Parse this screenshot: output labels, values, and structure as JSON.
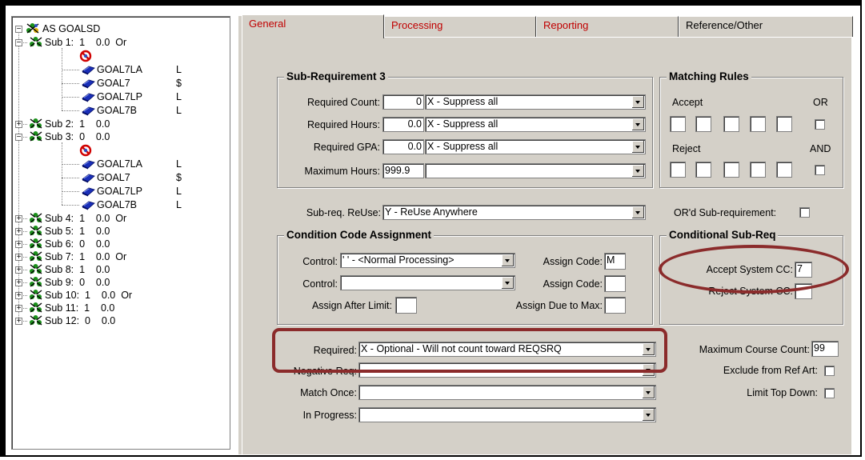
{
  "tree": {
    "root": "AS GOALSD",
    "subs": [
      {
        "label": "Sub 1:  1    0.0  Or",
        "expanded": true,
        "children": [
          {
            "name": "GOAL7LA",
            "tag": "L"
          },
          {
            "name": "GOAL7",
            "tag": "$"
          },
          {
            "name": "GOAL7LP",
            "tag": "L"
          },
          {
            "name": "GOAL7B",
            "tag": "L"
          }
        ]
      },
      {
        "label": "Sub 2:  1    0.0",
        "expanded": false
      },
      {
        "label": "Sub 3:  0    0.0",
        "expanded": true,
        "children": [
          {
            "name": "GOAL7LA",
            "tag": "L"
          },
          {
            "name": "GOAL7",
            "tag": "$"
          },
          {
            "name": "GOAL7LP",
            "tag": "L"
          },
          {
            "name": "GOAL7B",
            "tag": "L"
          }
        ]
      },
      {
        "label": "Sub 4:  1    0.0  Or",
        "expanded": false
      },
      {
        "label": "Sub 5:  1    0.0",
        "expanded": false
      },
      {
        "label": "Sub 6:  0    0.0",
        "expanded": false
      },
      {
        "label": "Sub 7:  1    0.0  Or",
        "expanded": false
      },
      {
        "label": "Sub 8:  1    0.0",
        "expanded": false
      },
      {
        "label": "Sub 9:  0    0.0",
        "expanded": false
      },
      {
        "label": "Sub 10:  1    0.0  Or",
        "expanded": false
      },
      {
        "label": "Sub 11:  1    0.0",
        "expanded": false
      },
      {
        "label": "Sub 12:  0    0.0",
        "expanded": false
      }
    ]
  },
  "tabs": [
    "General",
    "Processing",
    "Reporting",
    "Reference/Other"
  ],
  "subreq": {
    "title": "Sub-Requirement 3",
    "count_label": "Required Count:",
    "count": "0",
    "count_sel": "X - Suppress all",
    "hours_label": "Required Hours:",
    "hours": "0.0",
    "hours_sel": "X - Suppress all",
    "gpa_label": "Required GPA:",
    "gpa": "0.0",
    "gpa_sel": "X - Suppress all",
    "max_label": "Maximum Hours:",
    "max": "999.9",
    "max_sel": ""
  },
  "matching": {
    "title": "Matching Rules",
    "accept": "Accept",
    "or": "OR",
    "reject": "Reject",
    "and": "AND"
  },
  "reuse": {
    "label": "Sub-req. ReUse:",
    "value": "Y - ReUse Anywhere"
  },
  "ord": {
    "label": "OR'd Sub-requirement:"
  },
  "cca": {
    "title": "Condition Code Assignment",
    "control1_label": "Control:",
    "control1": "' ' - <Normal Processing>",
    "assign1_label": "Assign Code:",
    "assign1": "M",
    "control2_label": "Control:",
    "control2": "",
    "assign2_label": "Assign Code:",
    "assign2": "",
    "after_label": "Assign After Limit:",
    "due_label": "Assign Due to Max:"
  },
  "csr": {
    "title": "Conditional Sub-Req",
    "accept_label": "Accept System CC:",
    "accept": "7",
    "reject_label": "Reject System CC:",
    "reject": ""
  },
  "req": {
    "required_label": "Required:",
    "required": "X - Optional - Will not count toward REQSRQ",
    "neg_label": "Negative Req:",
    "neg": "",
    "once_label": "Match Once:",
    "once": "",
    "prog_label": "In Progress:",
    "prog": ""
  },
  "right": {
    "max_course_label": "Maximum Course Count:",
    "max_course": "99",
    "exclude_label": "Exclude from Ref Art:",
    "limit_label": "Limit Top Down:"
  },
  "colors": {
    "highlight": "#8b2b2b",
    "panel": "#d4d0c8",
    "tab_text": "#c00000"
  }
}
